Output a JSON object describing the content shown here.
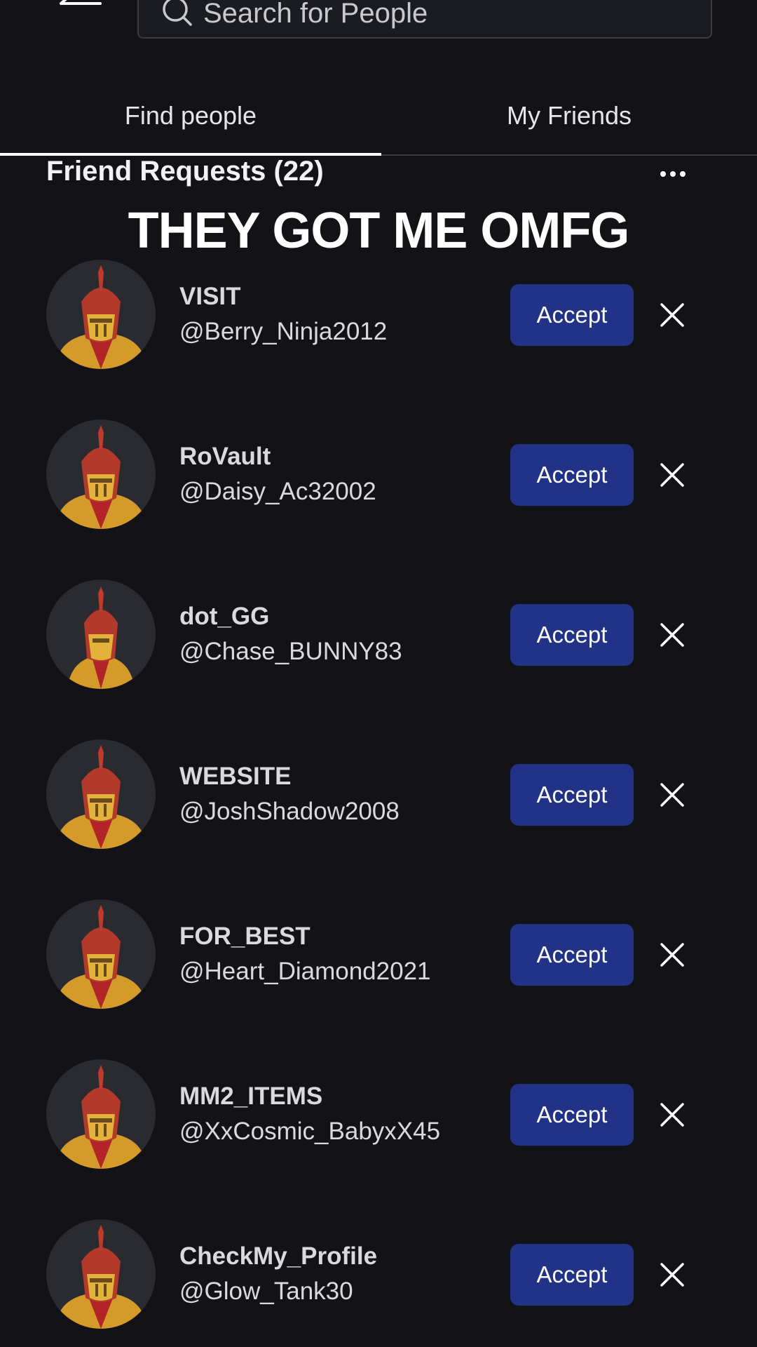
{
  "search": {
    "placeholder": "Search for People"
  },
  "tabs": [
    {
      "label": "Find people",
      "active": true
    },
    {
      "label": "My Friends",
      "active": false
    }
  ],
  "section": {
    "title": "Friend Requests (22)",
    "more_icon": "ellipsis-icon"
  },
  "caption": "THEY GOT ME OMFG",
  "requests": [
    {
      "display_name": "VISIT",
      "username": "@Berry_Ninja2012",
      "accept_label": "Accept"
    },
    {
      "display_name": "RoVault",
      "username": "@Daisy_Ac32002",
      "accept_label": "Accept"
    },
    {
      "display_name": "dot_GG",
      "username": "@Chase_BUNNY83",
      "accept_label": "Accept"
    },
    {
      "display_name": "WEBSITE",
      "username": "@JoshShadow2008",
      "accept_label": "Accept"
    },
    {
      "display_name": "FOR_BEST",
      "username": "@Heart_Diamond2021",
      "accept_label": "Accept"
    },
    {
      "display_name": "MM2_ITEMS",
      "username": "@XxCosmic_BabyxX45",
      "accept_label": "Accept"
    },
    {
      "display_name": "CheckMy_Profile",
      "username": "@Glow_Tank30",
      "accept_label": "Accept"
    }
  ],
  "colors": {
    "background": "#121217",
    "accept_button": "#223387",
    "text": "#d9dade"
  }
}
